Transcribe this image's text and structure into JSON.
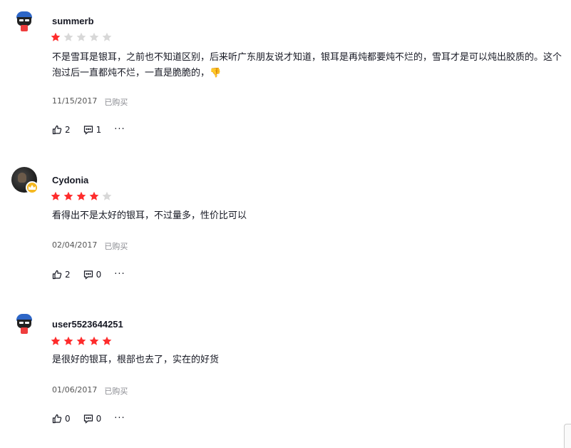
{
  "reviews": [
    {
      "username": "summerb",
      "avatar": "default-cap-avatar",
      "rating": 1,
      "max_rating": 5,
      "content": "不是雪耳是银耳，之前也不知道区别，后来听广东朋友说才知道，银耳是再炖都要炖不烂的，雪耳才是可以炖出胶质的。这个泡过后一直都炖不烂，一直是脆脆的，👎",
      "date": "11/15/2017",
      "purchased": "已购买",
      "likes": "2",
      "comments": "1"
    },
    {
      "username": "Cydonia",
      "avatar": "photo-avatar-with-crown-badge",
      "rating": 4,
      "max_rating": 5,
      "content": "看得出不是太好的银耳，不过量多，性价比可以",
      "date": "02/04/2017",
      "purchased": "已购买",
      "likes": "2",
      "comments": "0"
    },
    {
      "username": "user5523644251",
      "avatar": "default-cap-avatar",
      "rating": 5,
      "max_rating": 5,
      "content": "是很好的银耳，根部也去了，实在的好货",
      "date": "01/06/2017",
      "purchased": "已购买",
      "likes": "0",
      "comments": "0"
    }
  ],
  "colors": {
    "star_filled": "#fe2c2c",
    "star_empty": "#d8d8d8",
    "text": "#161823",
    "muted": "#8a8b91"
  },
  "icons": {
    "like": "thumbs-up-icon",
    "comment": "comment-icon",
    "more": "more-dots-icon",
    "crown": "crown-badge-icon"
  }
}
